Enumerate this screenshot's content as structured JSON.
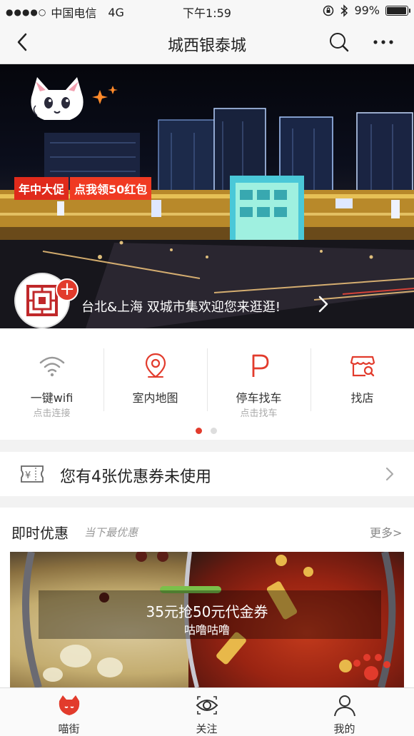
{
  "status_bar": {
    "carrier": "中国电信",
    "network": "4G",
    "time": "下午1:59",
    "battery": "99%",
    "battery_level": 0.99
  },
  "navbar": {
    "title": "城西银泰城"
  },
  "banner": {
    "promo_tag_1": "年中大促",
    "promo_tag_2": "点我领50红包",
    "caption": "台北&上海  双城市集欢迎您来逛逛!"
  },
  "quick_actions": [
    {
      "label": "一键wifi",
      "sub": "点击连接",
      "icon": "wifi-icon"
    },
    {
      "label": "室内地图",
      "sub": "",
      "icon": "location-pin-icon"
    },
    {
      "label": "停车找车",
      "sub": "点击找车",
      "icon": "parking-icon"
    },
    {
      "label": "找店",
      "sub": "",
      "icon": "store-search-icon"
    }
  ],
  "pager": {
    "pages": 2,
    "active": 0
  },
  "coupon": {
    "text": "您有4张优惠券未使用",
    "icon_text": "¥"
  },
  "deals": {
    "heading": "即时优惠",
    "subheading": "当下最优惠",
    "more": "更多",
    "item": {
      "title": "35元抢50元代金券",
      "subtitle": "咕噜咕噜"
    }
  },
  "tabbar": [
    {
      "label": "喵街",
      "icon": "cat-icon",
      "active": true
    },
    {
      "label": "关注",
      "icon": "eye-icon",
      "active": false
    },
    {
      "label": "我的",
      "icon": "user-icon",
      "active": false
    }
  ],
  "colors": {
    "accent": "#e23b2c",
    "muted": "#aaaaaa",
    "divider": "#f2f2f2"
  }
}
